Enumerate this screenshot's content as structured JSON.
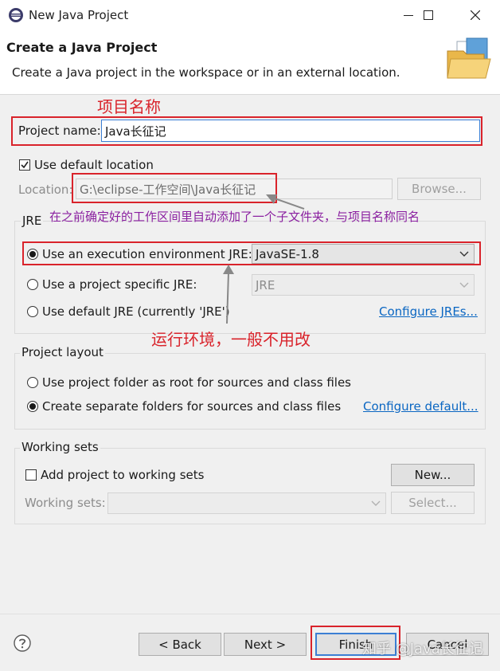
{
  "window": {
    "title": "New Java Project",
    "controls": {
      "minimize": "—",
      "maximize": "☐",
      "close": "✕"
    }
  },
  "header": {
    "heading": "Create a Java Project",
    "description": "Create a Java project in the workspace or in an external location."
  },
  "project": {
    "name_label": "Project name:",
    "name_value": "Java长征记"
  },
  "location": {
    "use_default_label": "Use default location",
    "use_default_checked": true,
    "label": "Location:",
    "value": "G:\\eclipse-工作空间\\Java长征记",
    "browse_label": "Browse..."
  },
  "jre": {
    "group_title": "JRE",
    "option_env_label": "Use an execution environment JRE:",
    "option_env_value": "JavaSE-1.8",
    "option_specific_label": "Use a project specific JRE:",
    "option_specific_value": "JRE",
    "option_default_label": "Use default JRE (currently 'JRE')",
    "configure_link": "Configure JREs...",
    "selected": "execution environment"
  },
  "layout": {
    "group_title": "Project layout",
    "option_root_label": "Use project folder as root for sources and class files",
    "option_separate_label": "Create separate folders for sources and class files",
    "configure_link": "Configure default...",
    "selected": "separate folders"
  },
  "working_sets": {
    "group_title": "Working sets",
    "add_label": "Add project to working sets",
    "new_button": "New...",
    "sets_label": "Working sets:",
    "select_button": "Select..."
  },
  "footer": {
    "back": "< Back",
    "next": "Next >",
    "finish": "Finish",
    "cancel": "Cancel"
  },
  "annotations": {
    "project_name_note": "项目名称",
    "location_note": "在之前确定好的工作区间里自动添加了一个子文件夹，与项目名称同名",
    "jre_note": "运行环境，一般不用改",
    "watermark": "知乎 @Java长征记"
  },
  "colors": {
    "annotation_red": "#d9232b",
    "annotation_purple": "#8a1fa0",
    "link_blue": "#0a66c2",
    "focus_blue": "#3c7fd4"
  }
}
